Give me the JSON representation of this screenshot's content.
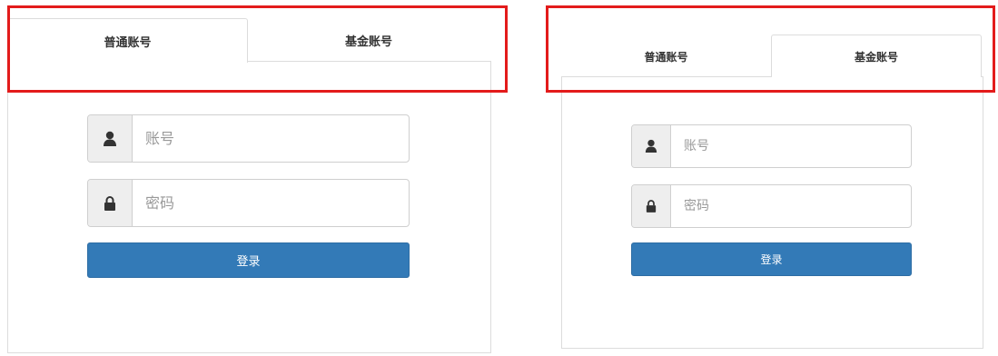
{
  "left_form": {
    "tabs": [
      {
        "label": "普通账号",
        "active": true
      },
      {
        "label": "基金账号",
        "active": false
      }
    ],
    "account_placeholder": "账号",
    "password_placeholder": "密码",
    "login_label": "登录"
  },
  "right_form": {
    "tabs": [
      {
        "label": "普通账号",
        "active": false
      },
      {
        "label": "基金账号",
        "active": true
      }
    ],
    "account_placeholder": "账号",
    "password_placeholder": "密码",
    "login_label": "登录"
  },
  "icons": {
    "account": "user-icon",
    "password": "lock-icon"
  },
  "colors": {
    "highlight": "#e31b1b",
    "primary_button": "#337ab7",
    "addon_bg": "#eeeeee"
  }
}
